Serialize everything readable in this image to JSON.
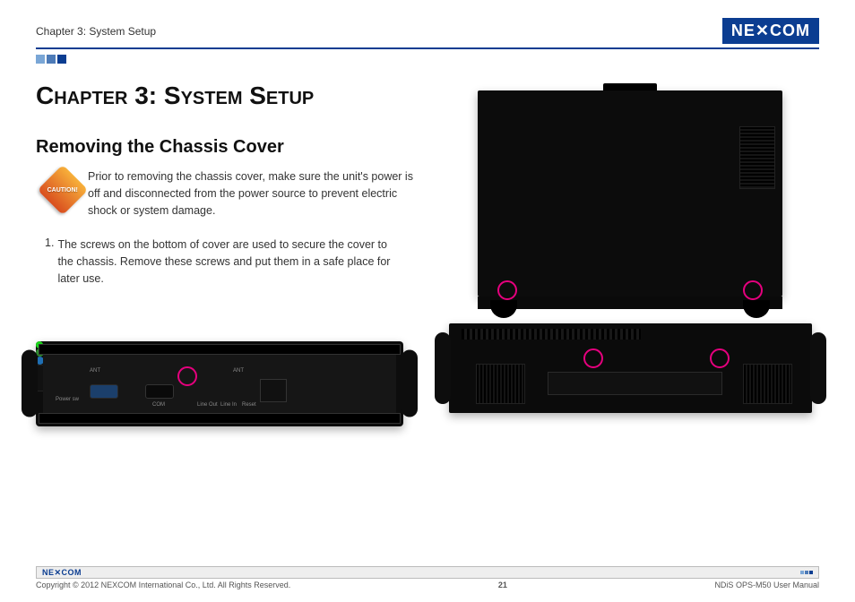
{
  "header": {
    "breadcrumb": "Chapter 3: System Setup",
    "logo_text": "NE✕COM"
  },
  "chapter": {
    "title": "Chapter 3: System Setup"
  },
  "section": {
    "heading": "Removing the Chassis Cover"
  },
  "caution": {
    "label": "CAUTION!",
    "text": "Prior to removing the chassis cover, make sure the unit's power is off and disconnected from the power source to prevent electric shock or system damage."
  },
  "steps": {
    "item1_num": "1.",
    "item1_text": "The screws on the bottom of cover are used to secure the cover to the chassis. Remove these screws and put them in a safe place for later use."
  },
  "front_panel": {
    "power": "Power sw",
    "ant1": "ANT",
    "ant2": "ANT",
    "com": "COM",
    "lineout": "Line Out",
    "linein": "Line In",
    "reset": "Reset"
  },
  "footer": {
    "logo": "NE✕COM",
    "copyright": "Copyright © 2012 NEXCOM International Co., Ltd. All Rights Reserved.",
    "page": "21",
    "doc": "NDiS OPS-M50 User Manual"
  }
}
